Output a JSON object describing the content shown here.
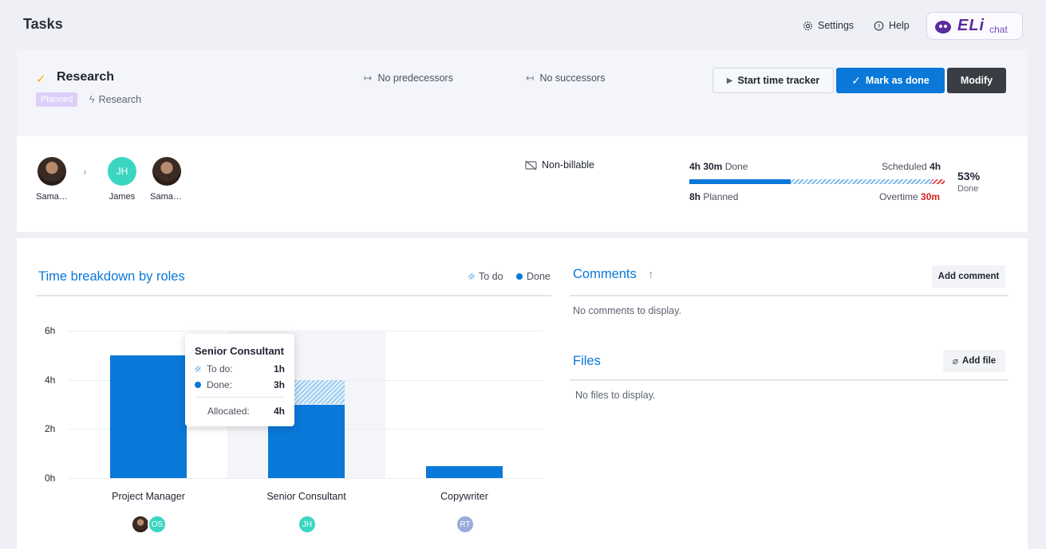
{
  "topbar": {
    "title": "Tasks",
    "settings_label": "Settings",
    "help_label": "Help",
    "eli_logo": "ELi",
    "eli_chat": "chat"
  },
  "task": {
    "title": "Research",
    "status_badge": "Planned",
    "project": "Research",
    "predecessors": "No predecessors",
    "successors": "No successors"
  },
  "actions": {
    "start_tracker": "Start time tracker",
    "mark_done": "Mark as done",
    "modify": "Modify"
  },
  "people": [
    {
      "name": "Sama…",
      "type": "photo"
    },
    {
      "name": "James",
      "initials": "JH",
      "type": "initials"
    },
    {
      "name": "Sama…",
      "type": "photo"
    }
  ],
  "billing": "Non-billable",
  "progress": {
    "done_value": "4h 30m",
    "done_label": "Done",
    "scheduled_label": "Scheduled",
    "scheduled_value": "4h",
    "planned_value": "8h",
    "planned_label": "Planned",
    "overtime_label": "Overtime",
    "overtime_value": "30m",
    "percent": "53%",
    "percent_label": "Done",
    "done_fraction": 0.53
  },
  "breakdown": {
    "title": "Time breakdown by roles",
    "legend_todo": "To do",
    "legend_done": "Done"
  },
  "chart_data": {
    "type": "bar",
    "stacked": true,
    "categories": [
      "Project Manager",
      "Senior Consultant",
      "Copywriter"
    ],
    "series": [
      {
        "name": "Done",
        "values": [
          5,
          3,
          0.5
        ]
      },
      {
        "name": "To do",
        "values": [
          0,
          1,
          0
        ]
      }
    ],
    "yticks": [
      "6h",
      "4h",
      "2h",
      "0h"
    ],
    "ylim": [
      0,
      6
    ],
    "grid": true,
    "legend": "top-right"
  },
  "role_avatars": [
    [
      "photo",
      "OS"
    ],
    [
      "JH"
    ],
    [
      "RT"
    ]
  ],
  "tooltip": {
    "title": "Senior Consultant",
    "todo_label": "To do:",
    "todo_value": "1h",
    "done_label": "Done:",
    "done_value": "3h",
    "allocated_label": "Allocated:",
    "allocated_value": "4h"
  },
  "comments": {
    "title": "Comments",
    "add_label": "Add comment",
    "empty": "No comments to display."
  },
  "files": {
    "title": "Files",
    "add_label": "Add file",
    "empty": "No files to display."
  },
  "colors": {
    "accent": "#0a78d8",
    "overtime": "#d41f1f",
    "check": "#f5b400",
    "avatar_jh": "#3bd6c2",
    "avatar_os": "#3bd6c2",
    "avatar_rt": "#9aabdc"
  }
}
